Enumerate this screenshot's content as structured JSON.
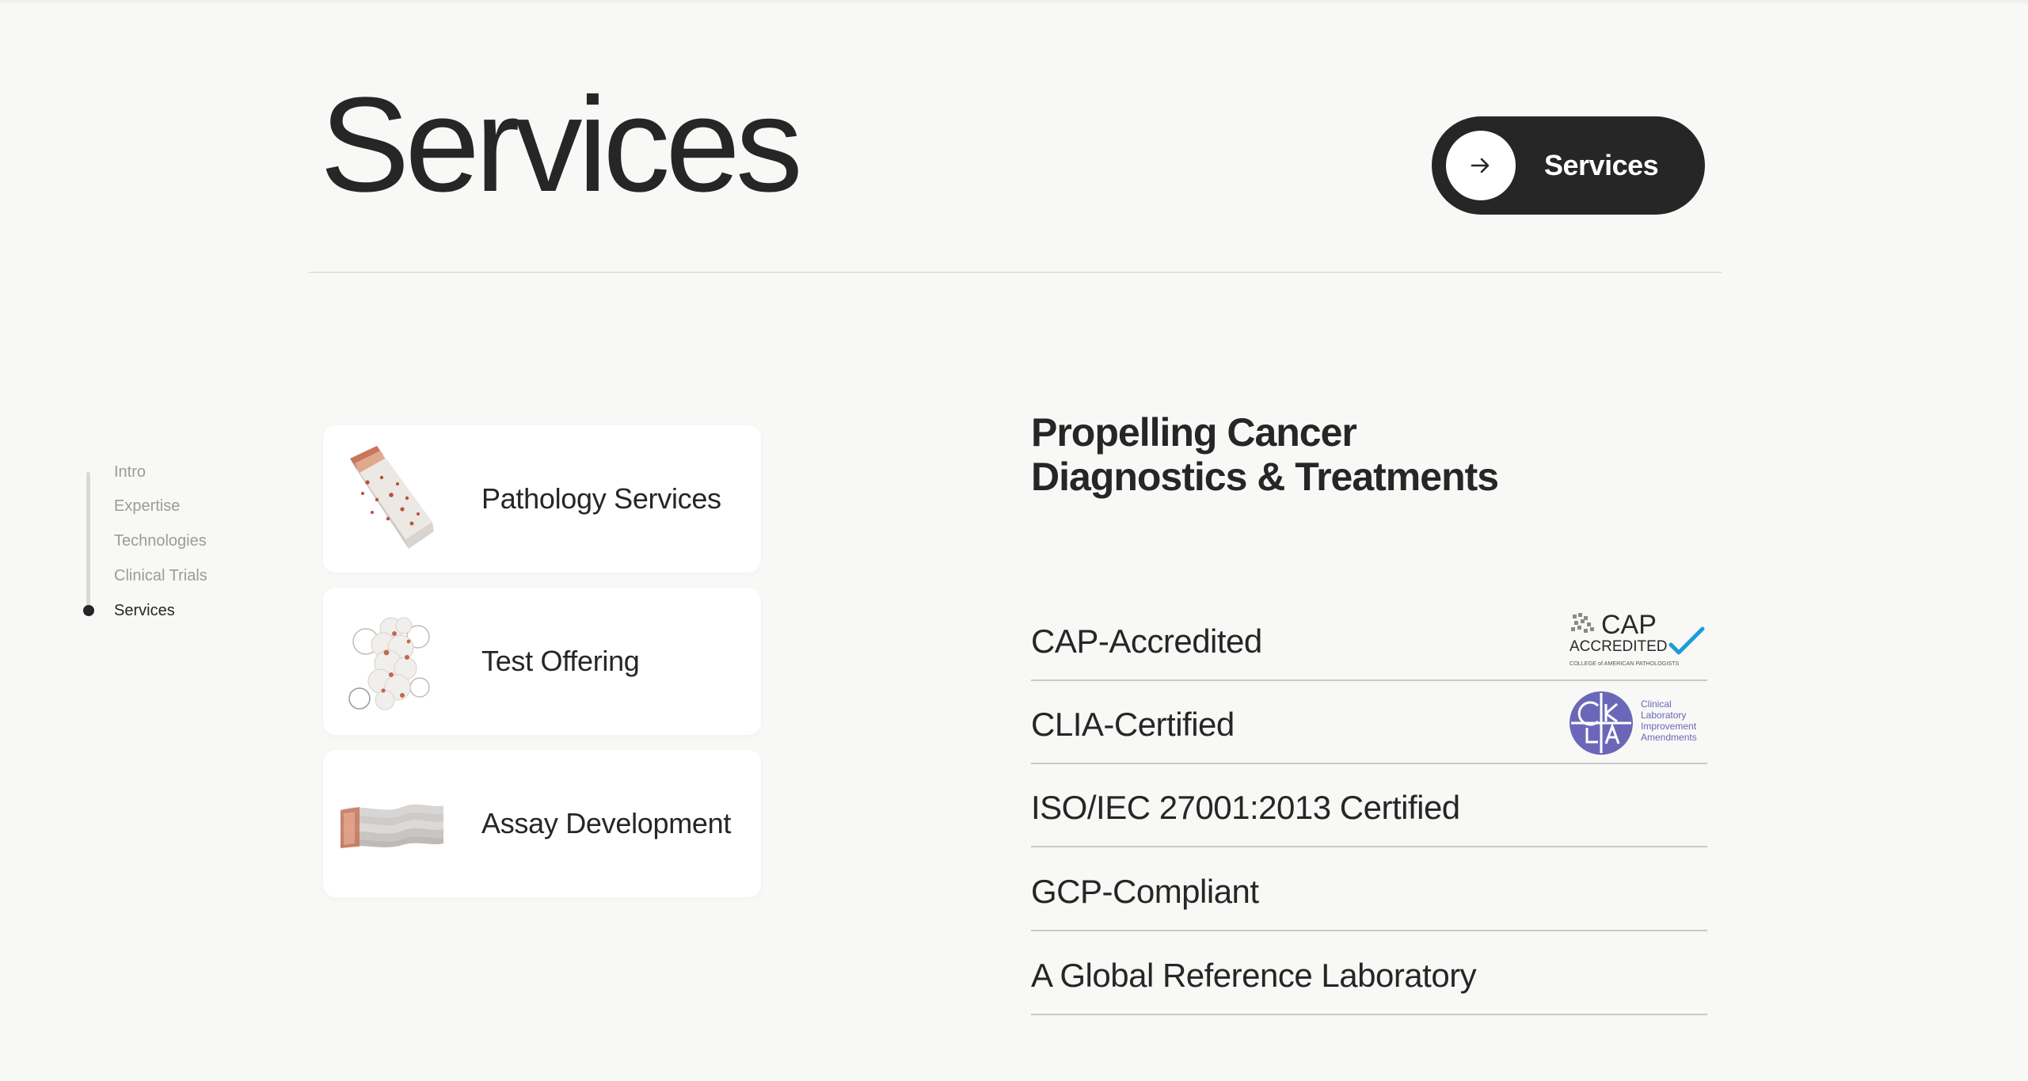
{
  "header": {
    "title": "Services",
    "button_label": "Services",
    "button_icon": "arrow-right-icon"
  },
  "side_nav": {
    "items": [
      {
        "label": "Intro",
        "active": false
      },
      {
        "label": "Expertise",
        "active": false
      },
      {
        "label": "Technologies",
        "active": false
      },
      {
        "label": "Clinical Trials",
        "active": false
      },
      {
        "label": "Services",
        "active": true
      }
    ]
  },
  "cards": [
    {
      "label": "Pathology Services",
      "icon": "pathology-tissue-block-image"
    },
    {
      "label": "Test Offering",
      "icon": "test-cell-cluster-image"
    },
    {
      "label": "Assay Development",
      "icon": "assay-slides-stack-image"
    }
  ],
  "headline": {
    "line1": "Propelling Cancer",
    "line2": "Diagnostics & Treatments"
  },
  "certifications": [
    {
      "label": "CAP-Accredited",
      "logo": "cap-accredited-logo"
    },
    {
      "label": "CLIA-Certified",
      "logo": "clia-logo"
    },
    {
      "label": "ISO/IEC 27001:2013 Certified",
      "logo": ""
    },
    {
      "label": "GCP-Compliant",
      "logo": ""
    },
    {
      "label": "A Global Reference Laboratory",
      "logo": ""
    }
  ],
  "logos": {
    "cap": {
      "word": "CAP",
      "sub": "ACCREDITED",
      "fine": "COLLEGE of AMERICAN PATHOLOGISTS"
    },
    "clia": {
      "lines": [
        "Clinical",
        "Laboratory",
        "Improvement",
        "Amendments"
      ]
    }
  },
  "colors": {
    "background": "#f8f8f6",
    "text_dark": "#262626",
    "nav_inactive": "#9b9b99",
    "cap_accent": "#1d9bd7",
    "clia_purple": "#6b67b8"
  }
}
